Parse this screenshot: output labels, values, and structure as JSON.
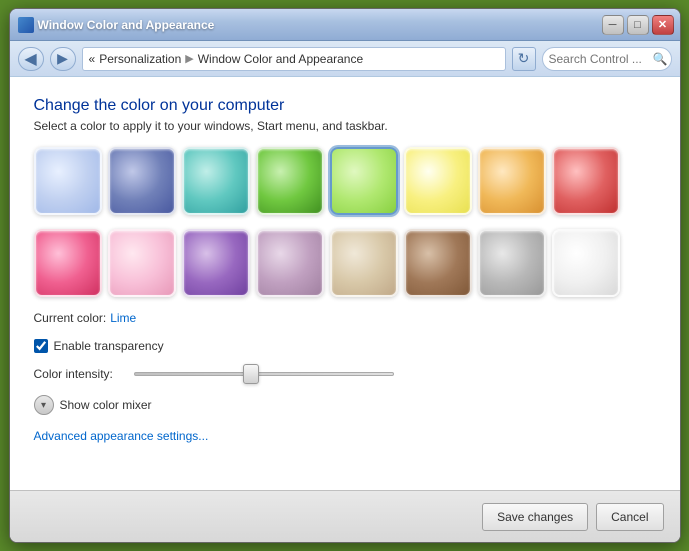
{
  "window": {
    "title": "Window Color and Appearance",
    "min_btn": "─",
    "max_btn": "□",
    "close_btn": "✕"
  },
  "addressbar": {
    "back_label": "◀",
    "forward_label": "▶",
    "refresh_label": "↻",
    "breadcrumb_prefix": "«",
    "breadcrumb_part1": "Personalization",
    "breadcrumb_sep": "▶",
    "breadcrumb_part2": "Window Color and Appearance",
    "search_placeholder": "Search Control ..."
  },
  "content": {
    "title": "Change the color on your computer",
    "subtitle": "Select a color to apply it to your windows, Start menu, and taskbar.",
    "current_color_label": "Current color:",
    "current_color_value": "Lime",
    "enable_transparency_label": "Enable transparency",
    "color_intensity_label": "Color intensity:",
    "show_color_mixer_label": "Show color mixer",
    "advanced_link": "Advanced appearance settings..."
  },
  "footer": {
    "save_label": "Save changes",
    "cancel_label": "Cancel"
  },
  "swatches": [
    {
      "id": "sky",
      "class": "sw-sky",
      "selected": false
    },
    {
      "id": "blue",
      "class": "sw-blue",
      "selected": false
    },
    {
      "id": "teal",
      "class": "sw-teal",
      "selected": false
    },
    {
      "id": "green",
      "class": "sw-green",
      "selected": false
    },
    {
      "id": "lime",
      "class": "sw-lime",
      "selected": true
    },
    {
      "id": "yellow",
      "class": "sw-yellow",
      "selected": false
    },
    {
      "id": "orange",
      "class": "sw-orange",
      "selected": false
    },
    {
      "id": "red",
      "class": "sw-red",
      "selected": false
    },
    {
      "id": "pink",
      "class": "sw-pink",
      "selected": false
    },
    {
      "id": "lpink",
      "class": "sw-lpink",
      "selected": false
    },
    {
      "id": "purple",
      "class": "sw-purple",
      "selected": false
    },
    {
      "id": "mauve",
      "class": "sw-mauve",
      "selected": false
    },
    {
      "id": "tan",
      "class": "sw-tan",
      "selected": false
    },
    {
      "id": "brown",
      "class": "sw-brown",
      "selected": false
    },
    {
      "id": "gray",
      "class": "sw-gray",
      "selected": false
    },
    {
      "id": "white",
      "class": "sw-white",
      "selected": false
    }
  ]
}
